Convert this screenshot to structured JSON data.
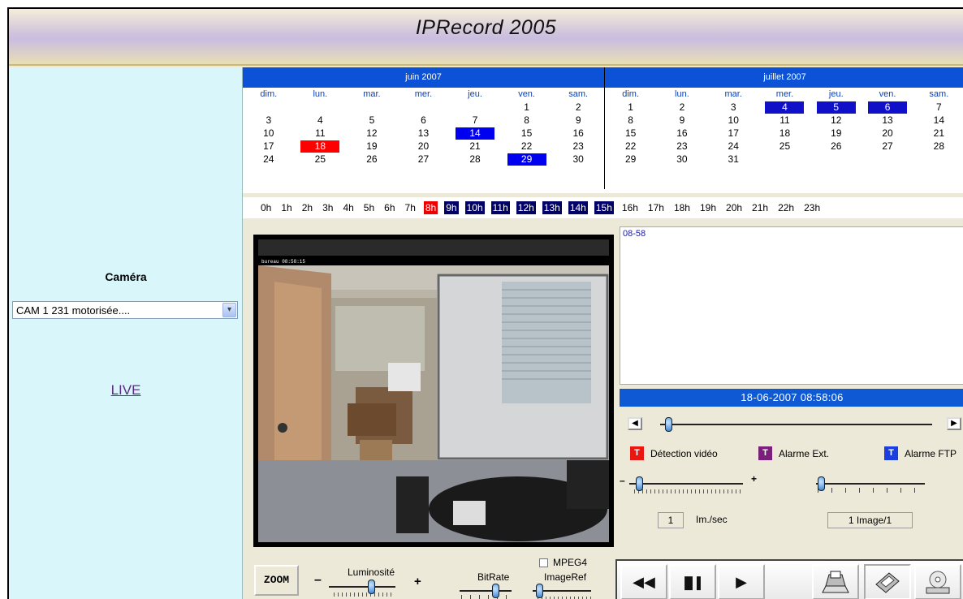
{
  "app": {
    "title": "IPRecord 2005"
  },
  "sidebar": {
    "camera_label": "Caméra",
    "camera_selected": "CAM 1 231 motorisée....",
    "live_link": "LIVE"
  },
  "calendars": [
    {
      "month": "juin 2007",
      "days_of_week": [
        "dim.",
        "lun.",
        "mar.",
        "mer.",
        "jeu.",
        "ven.",
        "sam."
      ],
      "weeks": [
        [
          "",
          "",
          "",
          "",
          "",
          "1",
          "2"
        ],
        [
          "3",
          "4",
          "5",
          "6",
          "7",
          "8",
          "9"
        ],
        [
          "10",
          "11",
          "12",
          "13",
          "14",
          "15",
          "16"
        ],
        [
          "17",
          "18",
          "19",
          "20",
          "21",
          "22",
          "23"
        ],
        [
          "24",
          "25",
          "26",
          "27",
          "28",
          "29",
          "30"
        ]
      ],
      "highlights": {
        "14": "blue",
        "18": "red",
        "29": "blue"
      }
    },
    {
      "month": "juillet 2007",
      "days_of_week": [
        "dim.",
        "lun.",
        "mar.",
        "mer.",
        "jeu.",
        "ven.",
        "sam."
      ],
      "weeks": [
        [
          "1",
          "2",
          "3",
          "4",
          "5",
          "6",
          "7"
        ],
        [
          "8",
          "9",
          "10",
          "11",
          "12",
          "13",
          "14"
        ],
        [
          "15",
          "16",
          "17",
          "18",
          "19",
          "20",
          "21"
        ],
        [
          "22",
          "23",
          "24",
          "25",
          "26",
          "27",
          "28"
        ],
        [
          "29",
          "30",
          "31",
          "",
          "",
          "",
          ""
        ]
      ],
      "highlights": {
        "4": "navy",
        "5": "navy",
        "6": "navy"
      }
    }
  ],
  "hours": [
    {
      "label": "0h",
      "state": ""
    },
    {
      "label": "1h",
      "state": ""
    },
    {
      "label": "2h",
      "state": ""
    },
    {
      "label": "3h",
      "state": ""
    },
    {
      "label": "4h",
      "state": ""
    },
    {
      "label": "5h",
      "state": ""
    },
    {
      "label": "6h",
      "state": ""
    },
    {
      "label": "7h",
      "state": ""
    },
    {
      "label": "8h",
      "state": "red"
    },
    {
      "label": "9h",
      "state": "navy"
    },
    {
      "label": "10h",
      "state": "navy"
    },
    {
      "label": "11h",
      "state": "navy"
    },
    {
      "label": "12h",
      "state": "navy"
    },
    {
      "label": "13h",
      "state": "navy"
    },
    {
      "label": "14h",
      "state": "navy"
    },
    {
      "label": "15h",
      "state": "navy"
    },
    {
      "label": "16h",
      "state": ""
    },
    {
      "label": "17h",
      "state": ""
    },
    {
      "label": "18h",
      "state": ""
    },
    {
      "label": "19h",
      "state": ""
    },
    {
      "label": "20h",
      "state": ""
    },
    {
      "label": "21h",
      "state": ""
    },
    {
      "label": "22h",
      "state": ""
    },
    {
      "label": "23h",
      "state": ""
    }
  ],
  "video": {
    "overlay_text": "bureau 08:58:15"
  },
  "events": {
    "items": [
      "08-58"
    ]
  },
  "timestamp": "18-06-2007  08:58:06",
  "legend": [
    {
      "letter": "T",
      "label": "Détection vidéo",
      "color": "#e8170f"
    },
    {
      "letter": "T",
      "label": "Alarme Ext.",
      "color": "#7a1f7a"
    },
    {
      "letter": "T",
      "label": "Alarme FTP",
      "color": "#1a3ee0"
    }
  ],
  "speed": {
    "minus": "–",
    "plus": "+",
    "value": "1",
    "unit": "Im./sec",
    "level": 0.0
  },
  "image_step": {
    "value": "1 Image/1",
    "level": 0.0
  },
  "bottom": {
    "zoom_label": "ZOOM",
    "luminosite_label": "Luminosité",
    "minus": "–",
    "plus": "+",
    "mpeg4_label": "MPEG4",
    "bitrate_label": "BitRate",
    "imageref_label": "ImageRef"
  },
  "player": {
    "rewind": "◀◀",
    "pause": "▐▌▌",
    "play": "▶"
  }
}
